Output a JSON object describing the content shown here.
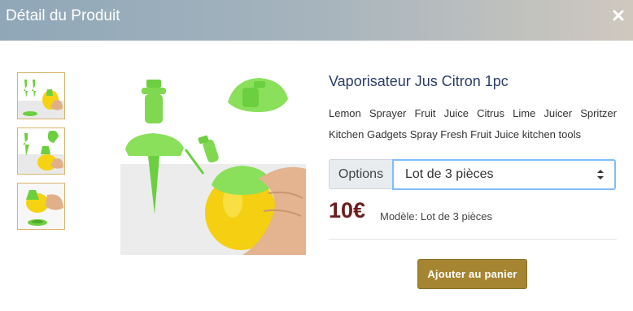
{
  "modal": {
    "title": "Détail du Produit",
    "close_icon": "close-icon",
    "header_gradient": [
      "#8fa7b8",
      "#cfc8bf"
    ]
  },
  "product": {
    "name": "Vaporisateur Jus Citron 1pc",
    "description_line1": "Lemon Sprayer Fruit Juice Citrus Lime Juicer Spritzer",
    "description_line2": "Kitchen Gadgets Spray Fresh Fruit Juice kitchen tools",
    "price": "10€",
    "model": "Modèle: Lot de 3 pièces",
    "thumbnails_count": 3
  },
  "options": {
    "label": "Options",
    "selected": "Lot de 3 pièces"
  },
  "actions": {
    "add_to_cart": "Ajouter au panier"
  },
  "colors": {
    "accent": "#a58531",
    "price": "#6b1e1e",
    "title": "#2a3e67",
    "focus_border": "#80bdff"
  }
}
